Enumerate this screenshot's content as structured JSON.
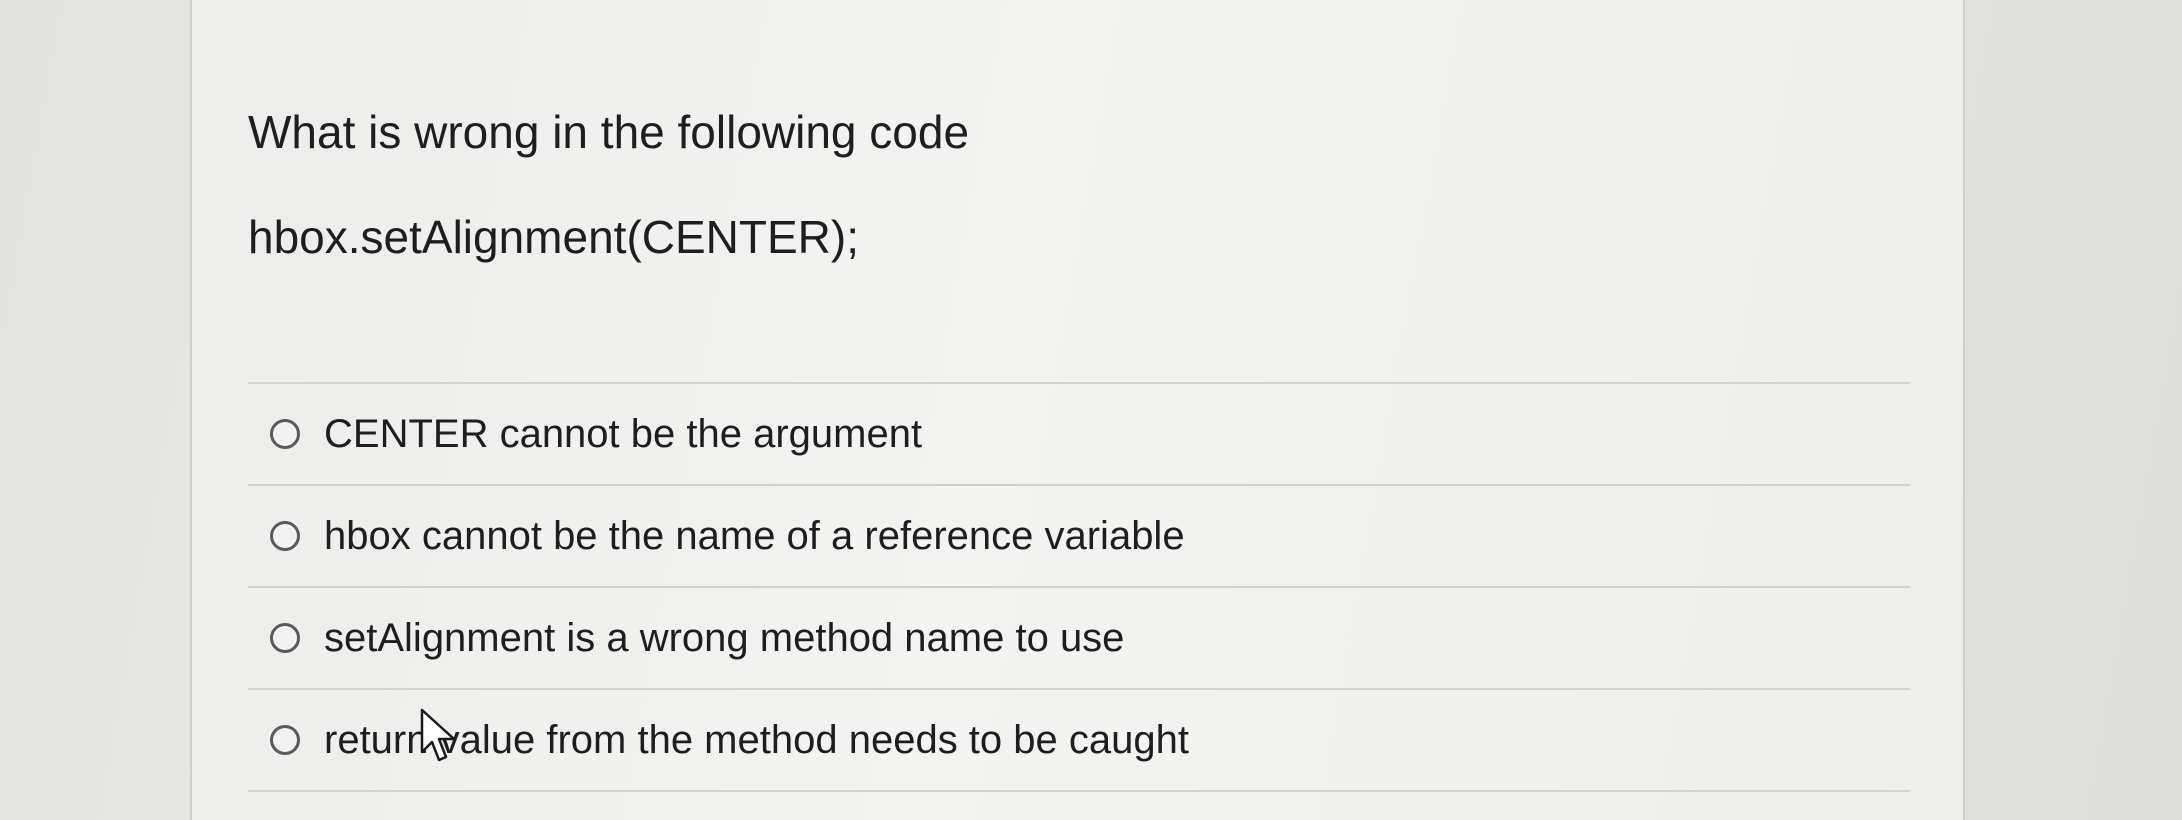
{
  "question": {
    "prompt": "What is wrong in the following code",
    "code": "hbox.setAlignment(CENTER);"
  },
  "answers": [
    {
      "label": "CENTER cannot be the argument",
      "selected": false
    },
    {
      "label": "hbox cannot be the name of a reference variable",
      "selected": false
    },
    {
      "label": "setAlignment is a wrong method name to use",
      "selected": false
    },
    {
      "label": "return value from the method needs to be caught",
      "selected": false
    }
  ],
  "icons": {
    "radio": "radio-button-icon",
    "cursor": "mouse-pointer-icon"
  },
  "colors": {
    "text": "#1e1e1e",
    "divider": "#d2d2cf",
    "radio_border": "#5a5a5a"
  }
}
